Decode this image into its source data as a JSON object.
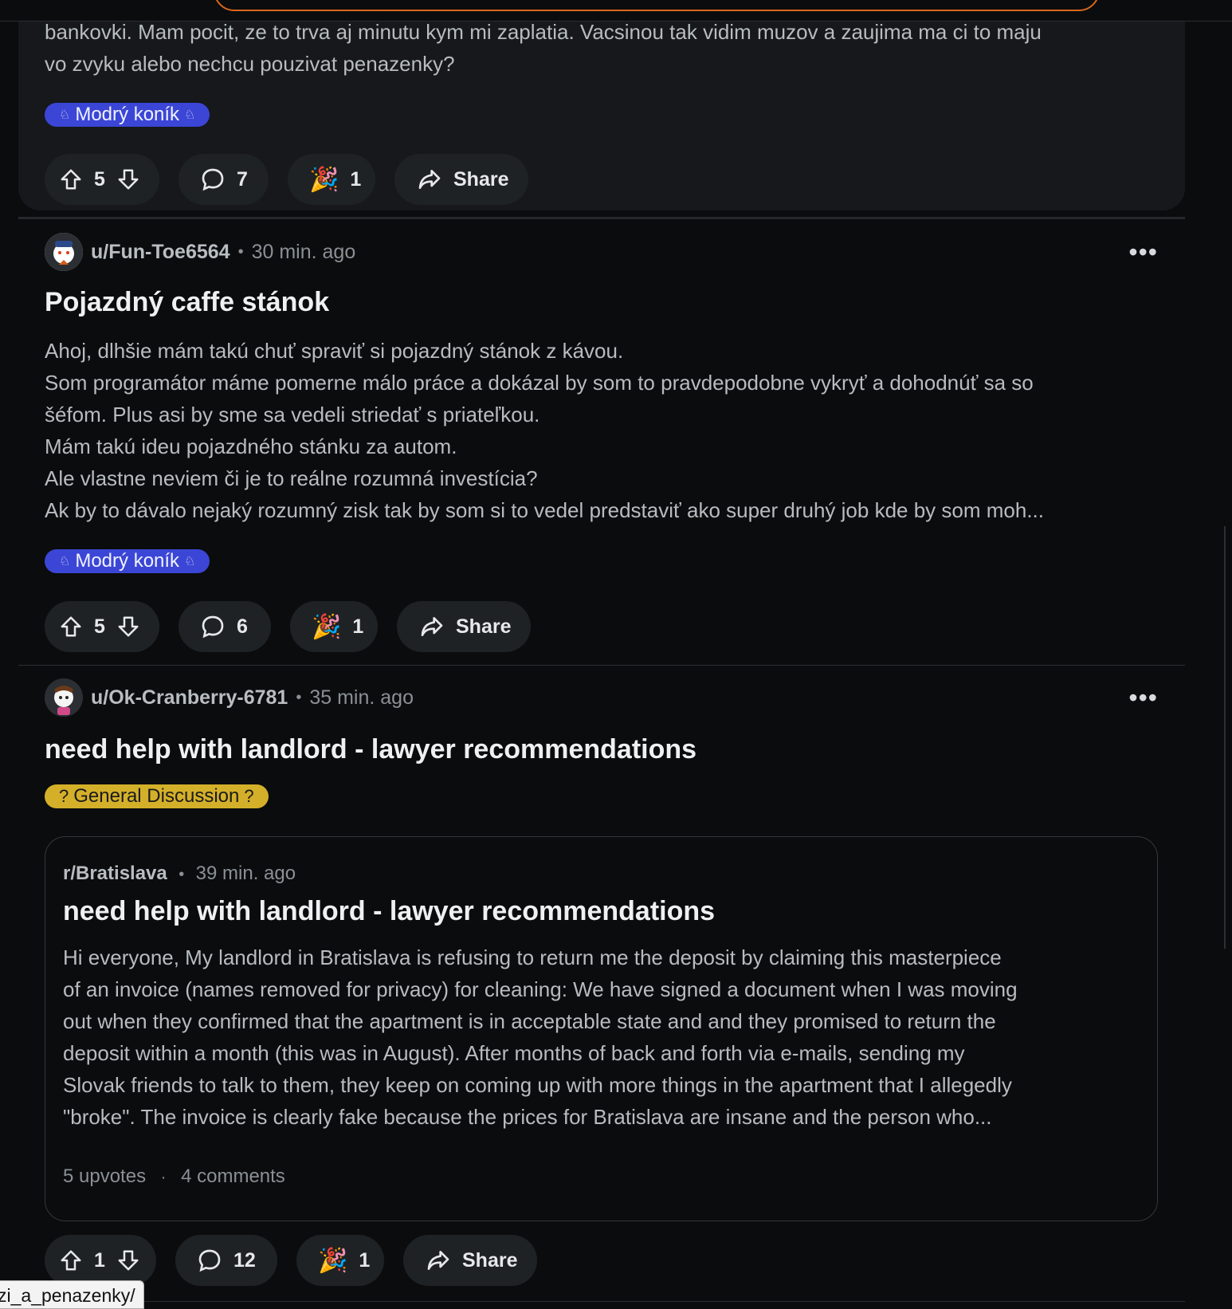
{
  "post1": {
    "body_lines": [
      "bankovki. Mam pocit, ze to trva aj minutu kym mi zaplatia. Vacsinou tak vidim muzov a zaujima ma ci to maju",
      "vo zvyku alebo nechcu pouzivat penazenky?"
    ],
    "flair": "Modrý koník",
    "upvotes": "5",
    "comments": "7",
    "awards": "1",
    "share": "Share"
  },
  "post2": {
    "author": "u/Fun-Toe6564",
    "time": "30 min. ago",
    "title": "Pojazdný caffe stánok",
    "body_lines": [
      "Ahoj, dlhšie mám takú chuť spraviť si pojazdný stánok z kávou.",
      "Som programátor máme pomerne málo práce a dokázal by som to pravdepodobne vykryť a dohodnúť sa so",
      "šéfom. Plus asi by sme sa vedeli striedať s priateľkou.",
      "Mám takú ideu pojazdného stánku za autom.",
      "Ale vlastne neviem či je to reálne rozumná investícia?",
      "Ak by to dávalo nejaký rozumný zisk tak by som si to vedel predstaviť ako super druhý job kde by som moh..."
    ],
    "flair": "Modrý koník",
    "upvotes": "5",
    "comments": "6",
    "awards": "1",
    "share": "Share"
  },
  "post3": {
    "author": "u/Ok-Cranberry-6781",
    "time": "35 min. ago",
    "title": "need help with landlord - lawyer recommendations",
    "flair": "General Discussion",
    "flair_icon": "?",
    "crosspost": {
      "subreddit": "r/Bratislava",
      "time": "39 min. ago",
      "title": "need help with landlord - lawyer recommendations",
      "body_lines": [
        "Hi everyone, My landlord in Bratislava is refusing to return me the deposit by claiming this masterpiece",
        "of an invoice (names removed for privacy) for cleaning: We have signed a document when I was moving",
        "out when they confirmed that the apartment is in acceptable state and and they promised to return the",
        "deposit within a month (this was in August). After months of back and forth via e-mails, sending my",
        "Slovak friends to talk to them, they keep on coming up with more things in the apartment that I allegedly",
        "\"broke\". The invoice is clearly fake because the prices for Bratislava are insane and the person who..."
      ],
      "upvotes_text": "5 upvotes",
      "comments_text": "4 comments"
    },
    "upvotes": "1",
    "comments": "12",
    "awards": "1",
    "share": "Share"
  },
  "status_url": "zi_a_penazenky/",
  "colors": {
    "background": "#0b0c0d",
    "flair_blue": "#3b46d6",
    "flair_yellow": "#d4b02a",
    "search_border": "#d8671d",
    "button_bg": "#1f2225"
  },
  "icons": [
    "upvote-icon",
    "downvote-icon",
    "comment-icon",
    "award-icon",
    "share-icon",
    "more-options-icon",
    "avatar-icon"
  ]
}
